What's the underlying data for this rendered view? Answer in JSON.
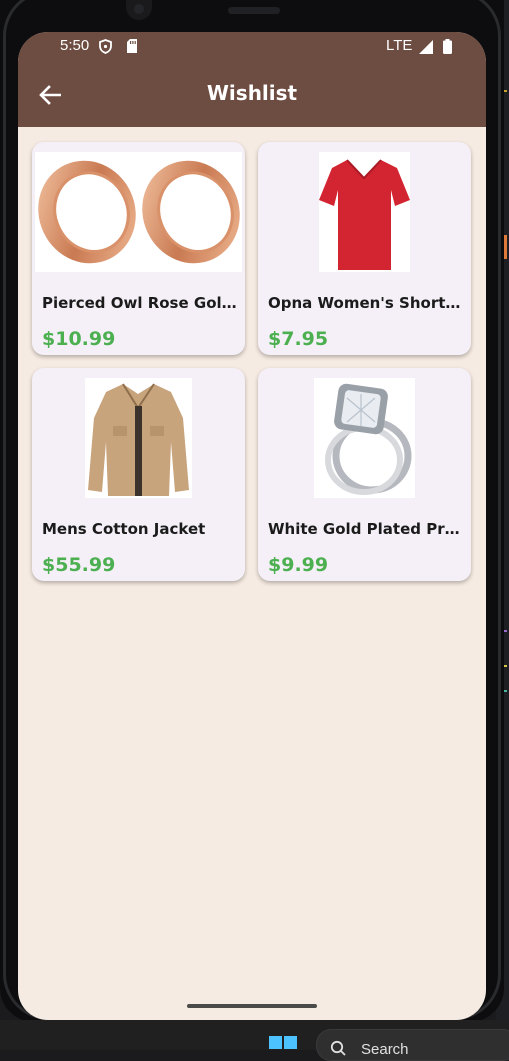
{
  "status_bar": {
    "time": "5:50",
    "network": "LTE",
    "icons": [
      "shield-icon",
      "sim-card-icon",
      "signal-icon",
      "battery-icon"
    ]
  },
  "app_bar": {
    "title": "Wishlist",
    "back_icon": "arrow-back-icon",
    "background": "#6d4c41"
  },
  "products": [
    {
      "name": "Pierced Owl Rose Gold Plated Stainless Steel Double Flared Tunnel Plug Earrings",
      "display_name": "Pierced Owl Rose Gold ...",
      "price": "$10.99",
      "image": "rose-gold-ear-tunnels-image"
    },
    {
      "name": "Opna Women's Short Sleeve Moisture",
      "display_name": "Opna Women's Short Sl...",
      "price": "$7.95",
      "image": "red-vneck-tshirt-image"
    },
    {
      "name": "Mens Cotton Jacket",
      "display_name": "Mens Cotton Jacket",
      "price": "$55.99",
      "image": "khaki-cotton-jacket-image"
    },
    {
      "name": "White Gold Plated Princess",
      "display_name": "White Gold Plated Prin...",
      "price": "$9.99",
      "image": "diamond-ring-set-image"
    }
  ],
  "colors": {
    "price": "#4caf50",
    "screen_background": "#f6ebe2",
    "card_background": "#f5f0f8"
  },
  "taskbar": {
    "search_label": "Search"
  }
}
